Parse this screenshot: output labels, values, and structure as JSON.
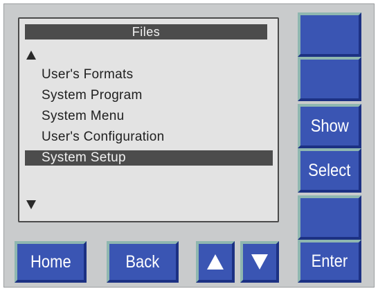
{
  "screen": {
    "title": "Files",
    "items": [
      {
        "label": "User's Formats"
      },
      {
        "label": "System Program"
      },
      {
        "label": "System Menu"
      },
      {
        "label": "User's Configuration"
      },
      {
        "label": "System Setup"
      }
    ],
    "selected_index": 4
  },
  "side_buttons": {
    "btn1_label": "",
    "btn2_label": "",
    "show_label": "Show",
    "select_label": "Select",
    "btn5_label": "",
    "enter_label": "Enter"
  },
  "bottom_buttons": {
    "home_label": "Home",
    "back_label": "Back",
    "up_icon": "up-triangle-icon",
    "down_icon": "down-triangle-icon"
  },
  "colors": {
    "button_blue": "#3a55b3",
    "button_highlight": "#8fb7b0",
    "panel_gray": "#c9cbcc",
    "lcd_background": "#e3e3e3",
    "selection_bar": "#4c4c4c"
  }
}
